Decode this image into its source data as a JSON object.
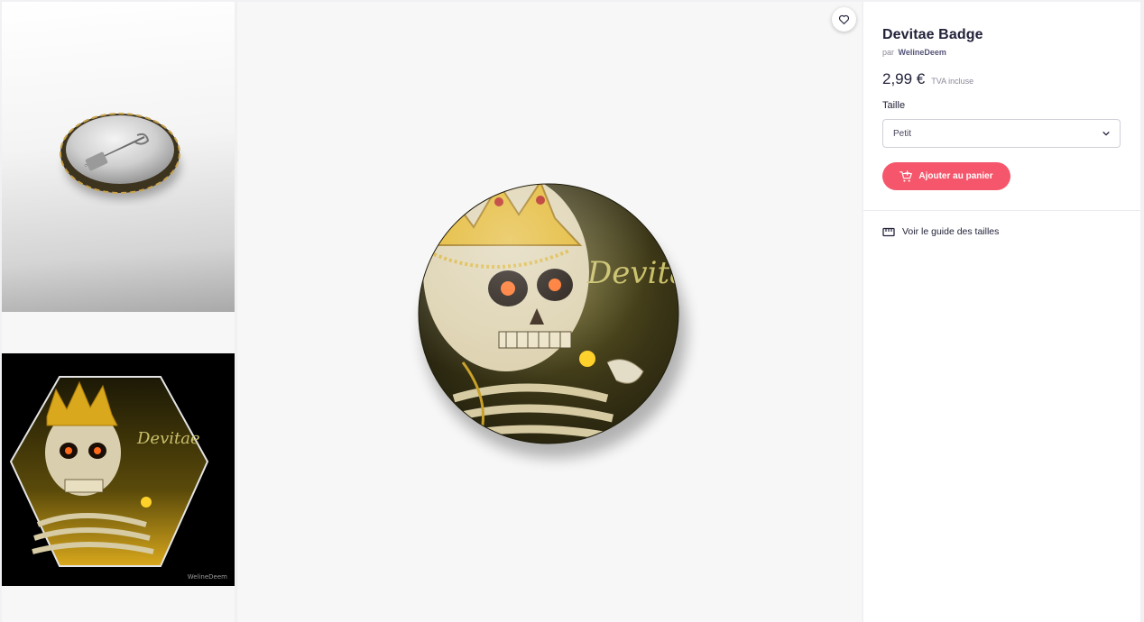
{
  "product": {
    "title": "Devitae Badge",
    "by_prefix": "par",
    "artist": "WelineDeem",
    "price": "2,99 €",
    "tax_note": "TVA incluse",
    "size_label": "Taille",
    "size_selected": "Petit",
    "add_to_cart": "Ajouter au panier",
    "size_guide": "Voir le guide des tailles"
  },
  "artwork": {
    "signature": "Devitae",
    "watermark": "WelineDeem"
  },
  "icons": {
    "favorite": "heart-icon",
    "dropdown": "chevron-down-icon",
    "cart": "cart-plus-icon",
    "guide": "ruler-icon"
  },
  "colors": {
    "accent": "#f5566b",
    "text": "#22223a",
    "muted": "#8a8a9a",
    "background": "#f7f7f7"
  }
}
